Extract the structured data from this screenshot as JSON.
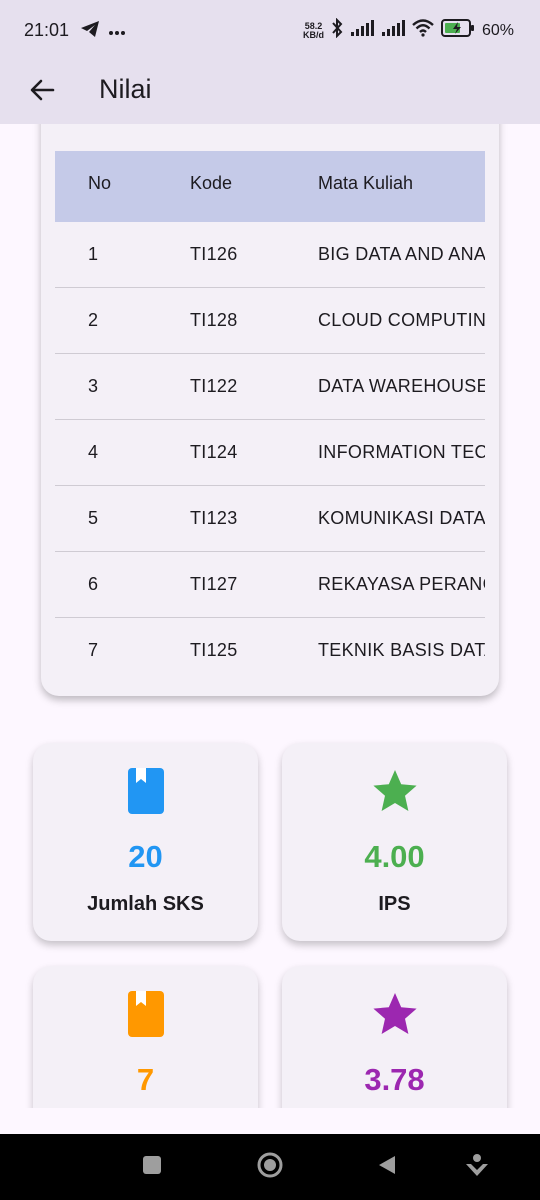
{
  "status_bar": {
    "time": "21:01",
    "net_speed_value": "58.2",
    "net_speed_unit": "KB/d",
    "battery_percent": "60%"
  },
  "app_bar": {
    "title": "Nilai"
  },
  "table": {
    "headers": {
      "no": "No",
      "kode": "Kode",
      "mata_kuliah": "Mata Kuliah"
    },
    "rows": [
      {
        "no": "1",
        "kode": "TI126",
        "mata_kuliah": "BIG DATA AND ANA"
      },
      {
        "no": "2",
        "kode": "TI128",
        "mata_kuliah": "CLOUD COMPUTING"
      },
      {
        "no": "3",
        "kode": "TI122",
        "mata_kuliah": "DATA WAREHOUSE"
      },
      {
        "no": "4",
        "kode": "TI124",
        "mata_kuliah": "INFORMATION TEC"
      },
      {
        "no": "5",
        "kode": "TI123",
        "mata_kuliah": "KOMUNIKASI DATA"
      },
      {
        "no": "6",
        "kode": "TI127",
        "mata_kuliah": "REKAYASA PERANG"
      },
      {
        "no": "7",
        "kode": "TI125",
        "mata_kuliah": "TEKNIK BASIS DATA"
      }
    ]
  },
  "stats": [
    {
      "icon": "book-icon",
      "value": "20",
      "label": "Jumlah SKS",
      "color": "#2196f3"
    },
    {
      "icon": "star-icon",
      "value": "4.00",
      "label": "IPS",
      "color": "#4caf50"
    },
    {
      "icon": "book-icon",
      "value": "7",
      "label": "",
      "color": "#ff9800"
    },
    {
      "icon": "star-icon",
      "value": "3.78",
      "label": "",
      "color": "#9c27b0"
    }
  ],
  "colors": {
    "app_bar_bg": "#e6e0ee",
    "page_bg": "#fdf7ff",
    "table_header_bg": "#c5cae8",
    "card_bg": "#f4f0f7"
  }
}
